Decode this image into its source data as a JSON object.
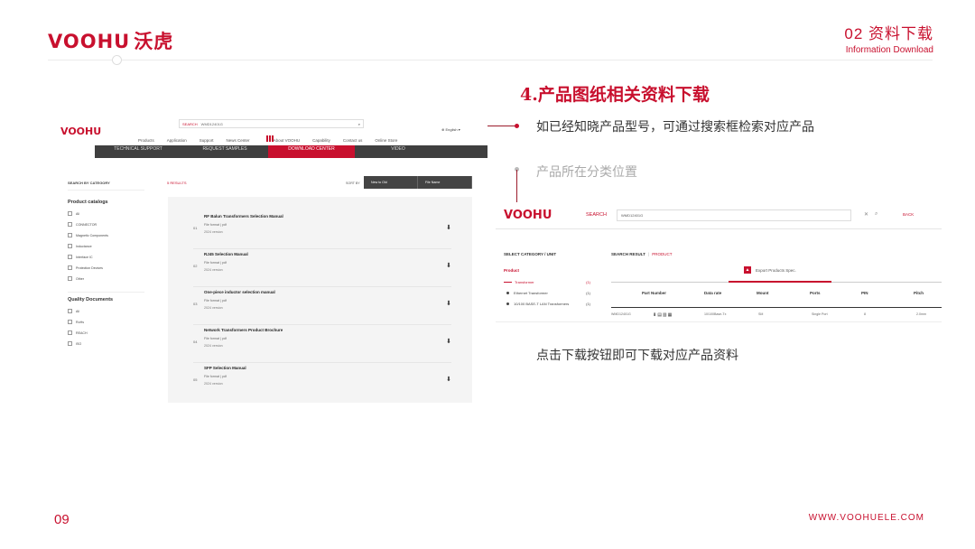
{
  "header": {
    "logo_en": "VOOHU",
    "logo_cn": "沃虎",
    "section": "02 资料下载",
    "section_en": "Information Download"
  },
  "footer": {
    "page": "09",
    "site": "WWW.VOOHUELE.COM"
  },
  "main": {
    "title": "4.产品图纸相关资料下载",
    "note1": "如已经知晓产品型号，可通过搜索框检索对应产品",
    "note2": "产品所在分类位置",
    "note3": "点击下载按钮即可下载对应产品资料"
  },
  "shot1": {
    "logo": "VOOHU",
    "search_label": "SEARCH",
    "search_value": "WMD12401G",
    "language": "⊕ English ▾",
    "nav": [
      "Products",
      "Application",
      "Support",
      "News Center",
      "About VOOHU",
      "Capability",
      "Contact us",
      "Online Store"
    ],
    "bar": [
      "TECHNICAL SUPPORT",
      "REQUEST SAMPLES",
      "DOWNLOAD CENTER",
      "VIDEO"
    ],
    "side_header": "SEARCH BY CATEGORY",
    "group1": "Product catalogs",
    "group1_items": [
      "All",
      "CONNECTOR",
      "Magnetic Components",
      "Inductance",
      "Interface IC",
      "Protection Devices",
      "Other"
    ],
    "group2": "Quality Documents",
    "group2_items": [
      "All",
      "RoHs",
      "REACH",
      "ISO"
    ],
    "results": "5 RESULTS",
    "sort_label": "SORT BY",
    "sort1": "New to Old",
    "sort2": "File Name",
    "rows": [
      {
        "num": "01",
        "title": "RF Balun Transformers Selection Manual",
        "meta": "File format  |  pdf",
        "ver": "2024 version"
      },
      {
        "num": "02",
        "title": "RJ45 Selection Manual",
        "meta": "File format  |  pdf",
        "ver": "2024 version"
      },
      {
        "num": "03",
        "title": "One-piece inductor selection manual",
        "meta": "File format  |  pdf",
        "ver": "2024 version"
      },
      {
        "num": "04",
        "title": "Network Transformers Product Brochure",
        "meta": "File format  |  pdf",
        "ver": "2024 version"
      },
      {
        "num": "05",
        "title": "SFP Selection Manual",
        "meta": "File format  |  pdf",
        "ver": "2024 version"
      }
    ]
  },
  "shot2": {
    "logo": "VOOHU",
    "search_label": "SEARCH",
    "search_value": "WMD12401G",
    "back": "BACK",
    "cat_header": "SELECT CATEGORY / UNIT",
    "product": "Product",
    "cats": [
      {
        "label": "Transformer",
        "count": "(1)"
      },
      {
        "label": "Ethernet Transformer",
        "count": "(1)"
      },
      {
        "label": "10/100 BASE-T LAN Transformers",
        "count": "(1)"
      }
    ],
    "search_result": "SEARCH RESULT",
    "product_tab": "PRODUCT",
    "export": "Export Products Spec.",
    "columns": [
      "Part Number",
      "Data rate",
      "Mount",
      "Ports",
      "PIN",
      "Pitch"
    ],
    "row": [
      "WMD12401G",
      "10/100Base-Tx",
      "SM",
      "Single Port",
      "8",
      "2.0mm"
    ]
  }
}
